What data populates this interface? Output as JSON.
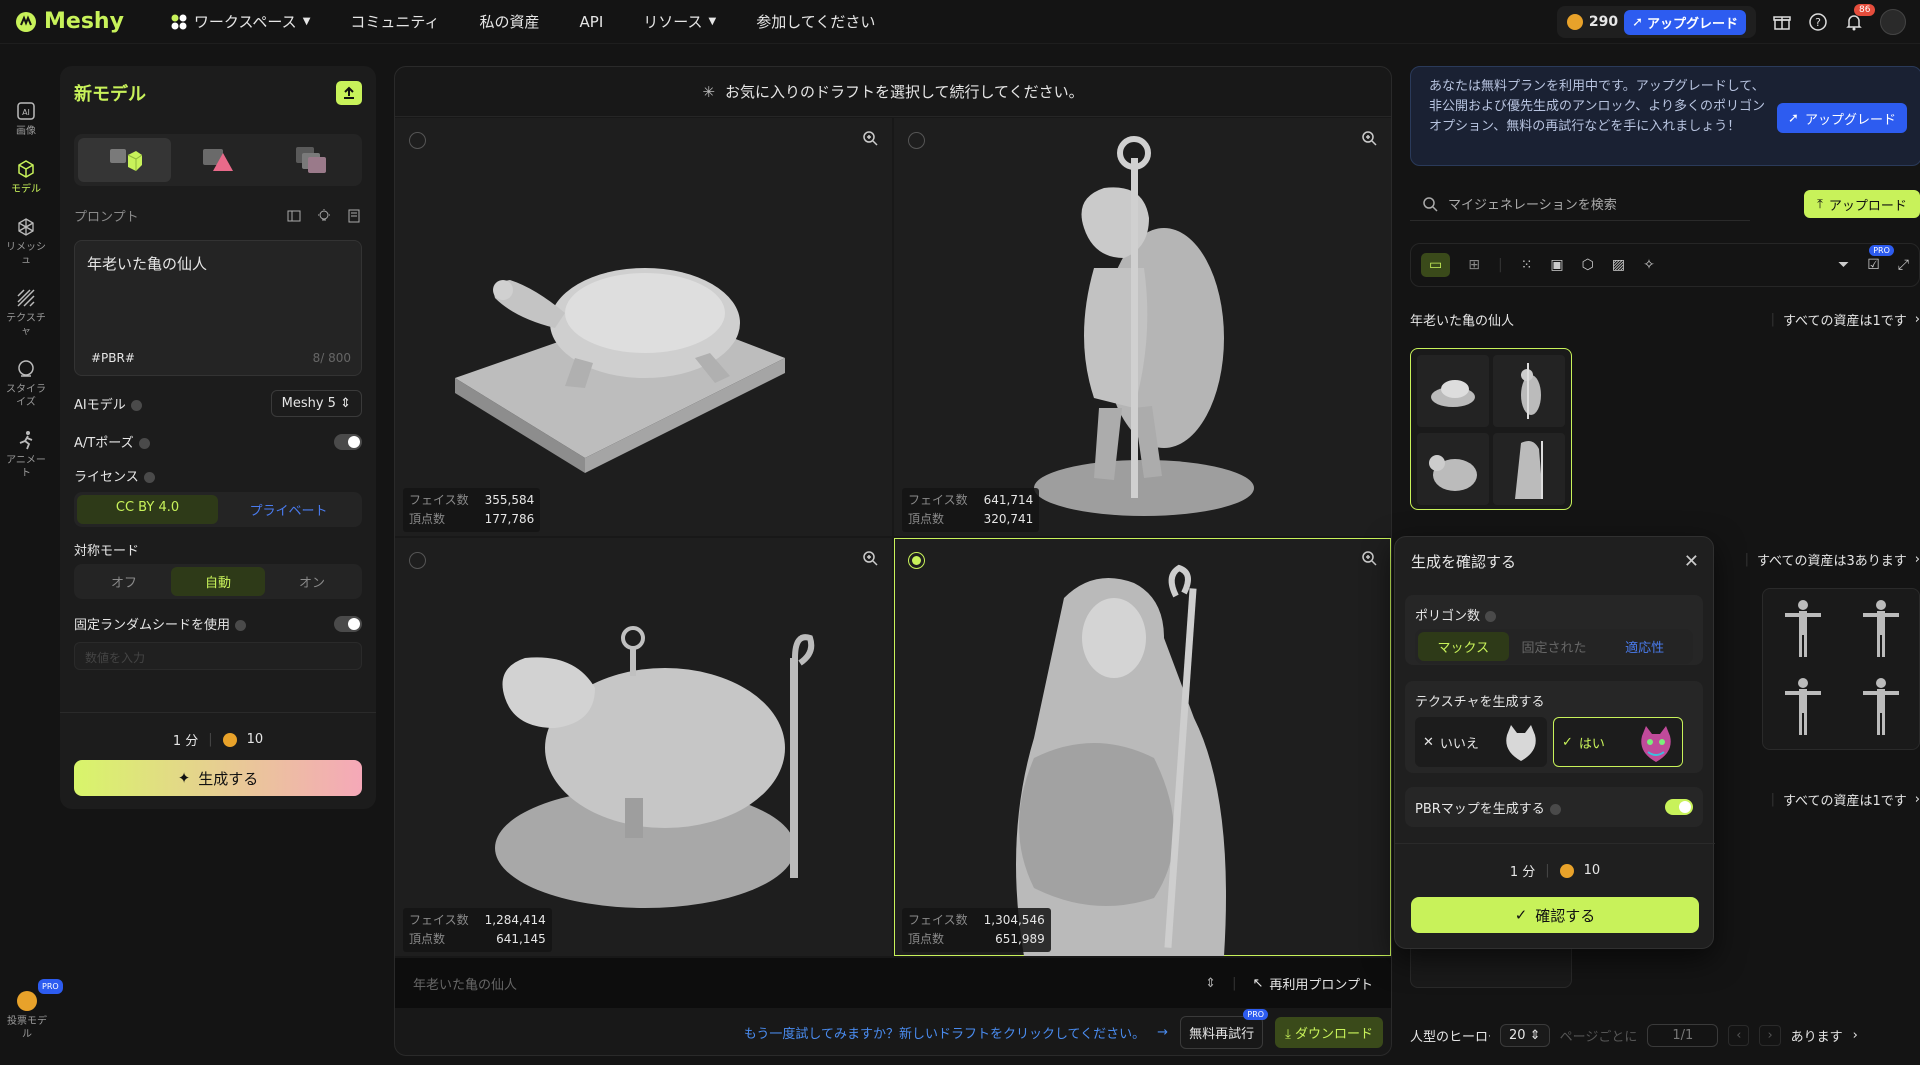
{
  "nav": {
    "logo": "Meshy",
    "workspace": "ワークスペース",
    "community": "コミュニティ",
    "assets": "私の資産",
    "api": "API",
    "resources": "リソース",
    "join": "参加してください",
    "credits": "290",
    "upgrade": "アップグレード",
    "notifications": "86"
  },
  "rail": [
    {
      "label": "画像",
      "icon": "image-ai-icon"
    },
    {
      "label": "モデル",
      "icon": "cube-icon"
    },
    {
      "label": "リメッシュ",
      "icon": "remesh-icon"
    },
    {
      "label": "テクスチャ",
      "icon": "texture-icon"
    },
    {
      "label": "スタイライズ",
      "icon": "stylize-icon"
    },
    {
      "label": "アニメート",
      "icon": "animate-icon"
    }
  ],
  "rail_bottom": {
    "label": "投票モデル",
    "pro": "PRO"
  },
  "left_panel": {
    "title": "新モデル",
    "prompt_label": "プロンプト",
    "prompt_text": "年老いた亀の仙人",
    "prompt_tag": "#PBR#",
    "prompt_count": "8/ 800",
    "ai_model_label": "AIモデル",
    "ai_model_value": "Meshy 5",
    "pose_label": "A/Tポーズ",
    "license_label": "ライセンス",
    "license_options": [
      "CC BY 4.0",
      "プライベート"
    ],
    "symmetry_label": "対称モード",
    "symmetry_options": [
      "オフ",
      "自動",
      "オン"
    ],
    "seed_label": "固定ランダムシードを使用",
    "seed_placeholder": "数値を入力",
    "time": "1 分",
    "cost": "10",
    "generate": "生成する"
  },
  "center": {
    "header": "お気に入りのドラフトを選択して続行してください。",
    "face_label": "フェイス数",
    "vertex_label": "頂点数",
    "drafts": [
      {
        "faces": "355,584",
        "vertices": "177,786",
        "selected": false
      },
      {
        "faces": "641,714",
        "vertices": "320,741",
        "selected": false
      },
      {
        "faces": "1,284,414",
        "vertices": "641,145",
        "selected": false
      },
      {
        "faces": "1,304,546",
        "vertices": "651,989",
        "selected": true
      }
    ],
    "prompt_bar": "年老いた亀の仙人",
    "reuse_prompt": "再利用プロンプト",
    "retry_text": "もう一度試してみますか？新しいドラフトをクリックしてください。",
    "free_retry": "無料再試行",
    "pro": "PRO",
    "download": "ダウンロード"
  },
  "right": {
    "banner": "あなたは無料プランを利用中です。アップグレードして、非公開および優先生成のアンロック、より多くのポリゴンオプション、無料の再試行などを手に入れましょう！",
    "banner_button": "アップグレード",
    "search_placeholder": "マイジェネレーションを検索",
    "upload": "アップロード",
    "pro": "PRO",
    "group1_title": "年老いた亀の仙人",
    "group1_count": "すべての資産は1です",
    "group2_count": "すべての資産は3あります",
    "group3_count": "すべての資産は1です",
    "group4_title": "人型のヒーロー",
    "group4_count": "あります",
    "per_page": "20",
    "per_page_label": "ページごとに",
    "page": "1/1"
  },
  "popup": {
    "title": "生成を確認する",
    "polygon_label": "ポリゴン数",
    "polygon_options": [
      "マックス",
      "固定された",
      "適応性"
    ],
    "texture_label": "テクスチャを生成する",
    "texture_no": "いいえ",
    "texture_yes": "はい",
    "pbr_label": "PBRマップを生成する",
    "time": "1 分",
    "cost": "10",
    "confirm": "確認する"
  },
  "colors": {
    "accent": "#c8f25a",
    "blue": "#2d5cf0",
    "bg": "#141414"
  }
}
